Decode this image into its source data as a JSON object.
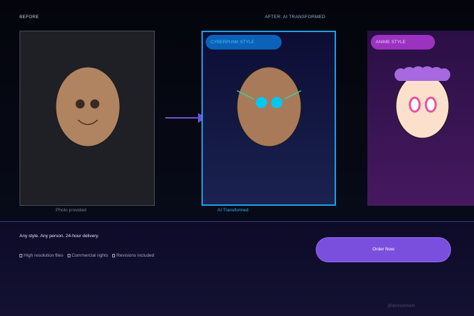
{
  "labels": {
    "before": "BEFORE",
    "after": "AFTER: AI TRANSFORMED"
  },
  "cards": {
    "before": {
      "caption": "Photo provided"
    },
    "cyber": {
      "pill": "CYBERPUNK STYLE",
      "caption": "AI Transformed"
    },
    "anime": {
      "pill": "ANIME STYLE"
    }
  },
  "bottom": {
    "tagline": "Any style. Any person. 24-hour delivery.",
    "features": [
      "High resolution files",
      "Commercial rights",
      "Revisions included"
    ],
    "order_label": "Order Now",
    "handle": "@demostream"
  },
  "colors": {
    "accent": "#7a4fde",
    "cyber_border": "#1ea0e8",
    "cyber_eyes": "#00c8f0",
    "anime_hair": "#a868e0",
    "skin": "#b08460"
  }
}
